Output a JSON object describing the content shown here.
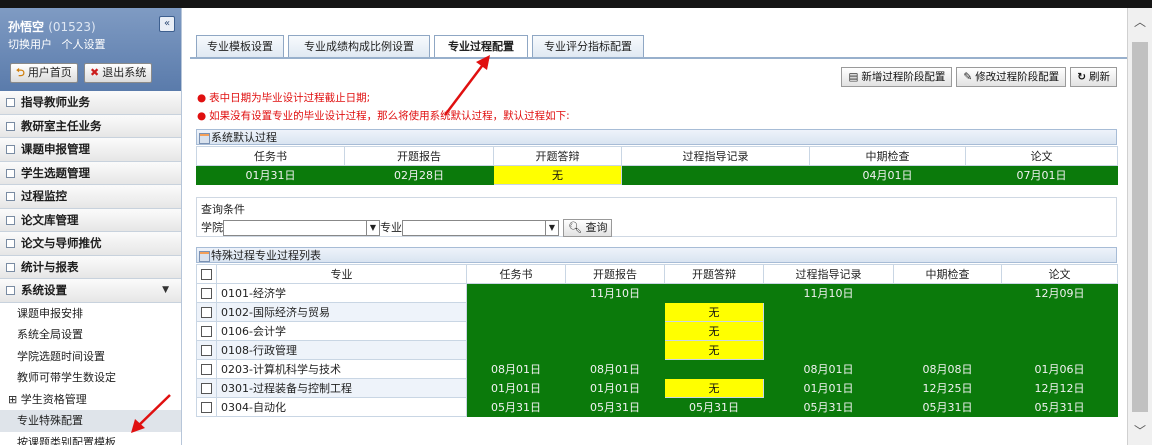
{
  "user": {
    "name": "孙悟空",
    "id": "(01523)",
    "switch_user": "切换用户",
    "settings": "个人设置",
    "home_btn": "用户首页",
    "logout_btn": "退出系统",
    "collapse": "«"
  },
  "menu": [
    {
      "label": "指导教师业务"
    },
    {
      "label": "教研室主任业务"
    },
    {
      "label": "课题申报管理"
    },
    {
      "label": "学生选题管理"
    },
    {
      "label": "过程监控"
    },
    {
      "label": "论文库管理"
    },
    {
      "label": "论文与导师推优"
    },
    {
      "label": "统计与报表"
    },
    {
      "label": "系统设置"
    }
  ],
  "submenu": [
    {
      "label": "课题申报安排"
    },
    {
      "label": "系统全局设置"
    },
    {
      "label": "学院选题时间设置"
    },
    {
      "label": "教师可带学生数设定"
    },
    {
      "label": "学生资格管理",
      "expander": "⊞"
    },
    {
      "label": "专业特殊配置"
    },
    {
      "label": "按课题类别配置模板"
    }
  ],
  "tabs": [
    "专业模板设置",
    "专业成绩构成比例设置",
    "专业过程配置",
    "专业评分指标配置"
  ],
  "toolbar": {
    "add": "新增过程阶段配置",
    "edit": "修改过程阶段配置",
    "refresh": "刷新"
  },
  "notes": [
    "表中日期为毕业设计过程截止日期;",
    "如果没有设置专业的毕业设计过程，那么将使用系统默认过程，默认过程如下:"
  ],
  "default_panel": {
    "title": "系统默认过程",
    "headers": [
      "任务书",
      "开题报告",
      "开题答辩",
      "过程指导记录",
      "中期检查",
      "论文"
    ],
    "values": [
      "01月31日",
      "02月28日",
      "无",
      "",
      "04月01日",
      "07月01日"
    ]
  },
  "query": {
    "title": "查询条件",
    "college_label": "学院",
    "major_label": "专业",
    "button": "查询"
  },
  "special_panel": {
    "title": "特殊过程专业过程列表",
    "headers": [
      "专业",
      "任务书",
      "开题报告",
      "开题答辩",
      "过程指导记录",
      "中期检查",
      "论文"
    ],
    "rows": [
      {
        "major": "0101-经济学",
        "cells": [
          "",
          "11月10日",
          "",
          "11月10日",
          "",
          "12月09日"
        ]
      },
      {
        "major": "0102-国际经济与贸易",
        "cells": [
          "",
          "",
          "无",
          "",
          "",
          ""
        ]
      },
      {
        "major": "0106-会计学",
        "cells": [
          "",
          "",
          "无",
          "",
          "",
          ""
        ]
      },
      {
        "major": "0108-行政管理",
        "cells": [
          "",
          "",
          "无",
          "",
          "",
          ""
        ]
      },
      {
        "major": "0203-计算机科学与技术",
        "cells": [
          "08月01日",
          "08月01日",
          "",
          "08月01日",
          "08月08日",
          "01月06日"
        ]
      },
      {
        "major": "0301-过程装备与控制工程",
        "cells": [
          "01月01日",
          "01月01日",
          "无",
          "01月01日",
          "12月25日",
          "12月12日"
        ]
      },
      {
        "major": "0304-自动化",
        "cells": [
          "05月31日",
          "05月31日",
          "05月31日",
          "05月31日",
          "05月31日",
          "05月31日"
        ]
      }
    ]
  },
  "colors": {
    "green": "#0b7a0b",
    "yellow": "#ffff00",
    "note_red": "#e01010"
  }
}
